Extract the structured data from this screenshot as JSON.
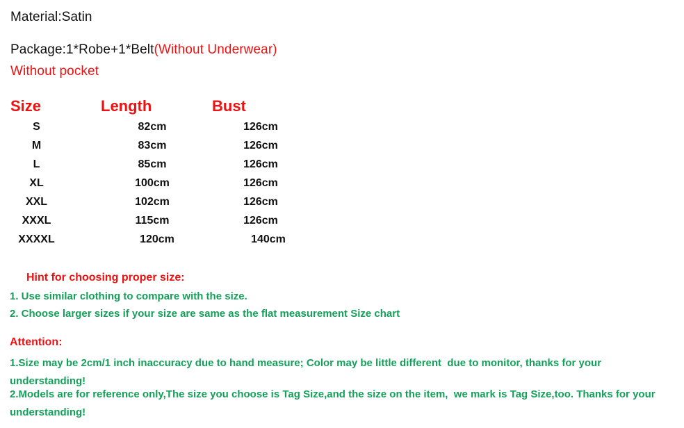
{
  "colors": {
    "red": "#ee1111",
    "green": "#15a05a",
    "black": "#111111",
    "background": "#ffffff"
  },
  "intro": {
    "material": "Material:Satin",
    "package_black": "Package:1*Robe+1*Belt",
    "package_red": "(Without Underwear)",
    "pocket": "Without pocket"
  },
  "size_chart": {
    "headers": [
      "Size",
      "Length",
      "Bust"
    ],
    "rows": [
      {
        "size": "S",
        "length": "82cm",
        "bust": "126cm"
      },
      {
        "size": "M",
        "length": "83cm",
        "bust": "126cm"
      },
      {
        "size": "L",
        "length": "85cm",
        "bust": "126cm"
      },
      {
        "size": "XL",
        "length": "100cm",
        "bust": "126cm"
      },
      {
        "size": "XXL",
        "length": "102cm",
        "bust": "126cm"
      },
      {
        "size": "XXXL",
        "length": "115cm",
        "bust": "126cm"
      },
      {
        "size": "XXXXL",
        "length": "120cm",
        "bust": "140cm"
      }
    ]
  },
  "hint": {
    "title": "Hint for choosing proper size:",
    "line_1": "1. Use similar clothing to compare with the size.",
    "line_2": "2. Choose larger sizes if your size are same as the flat measurement Size chart"
  },
  "attention": {
    "title": "Attention:",
    "item_1": "1.Size may be 2cm/1 inch inaccuracy due to hand measure; Color may be little different  due to monitor, thanks for your understanding!",
    "item_2": "2.Models are for reference only,The size you choose is Tag Size,and the size on the item,  we mark is Tag Size,too. Thanks for your understanding!"
  }
}
